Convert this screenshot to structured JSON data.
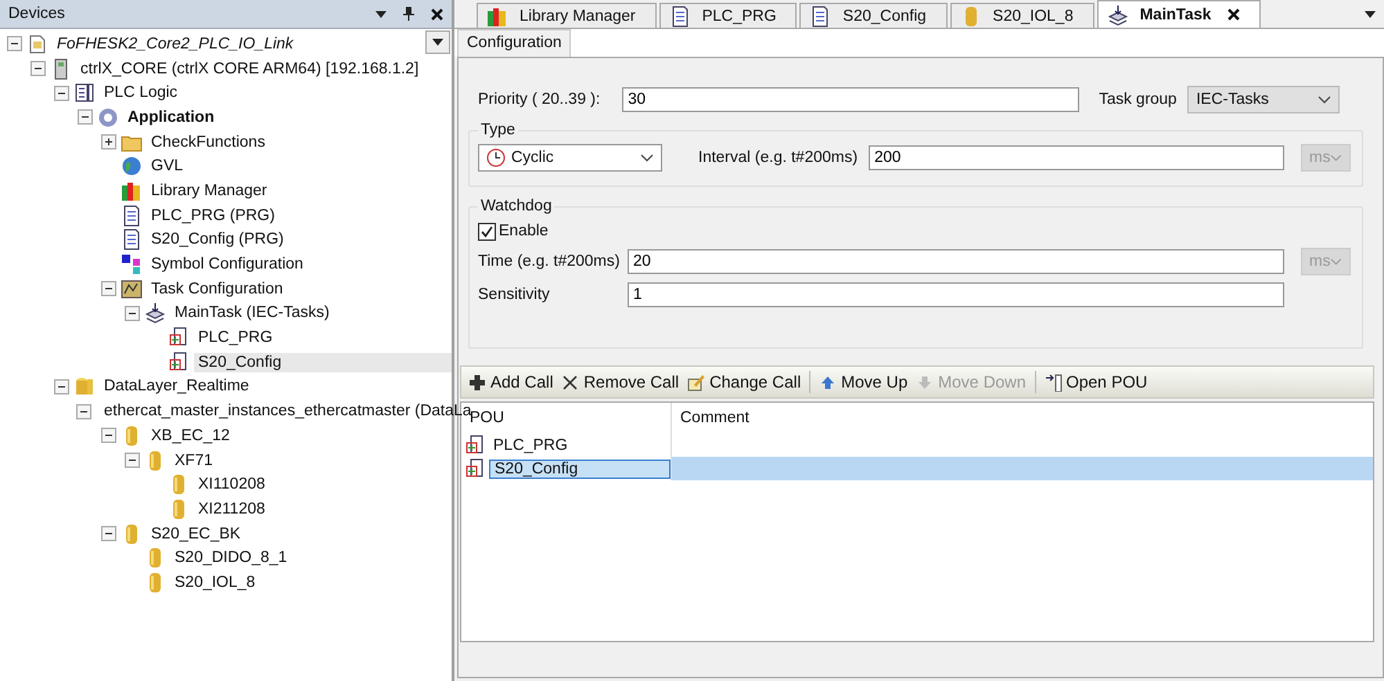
{
  "devices_panel": {
    "title": "Devices",
    "tree": [
      {
        "label": "FoFHESK2_Core2_PLC_IO_Link",
        "kind": "project",
        "expanded": true,
        "selected": false,
        "children": [
          {
            "label": "ctrlX_CORE (ctrlX CORE ARM64) [192.168.1.2]",
            "kind": "device",
            "expanded": true,
            "selected": false,
            "children": [
              {
                "label": "PLC Logic",
                "kind": "plc",
                "expanded": true,
                "selected": false,
                "children": [
                  {
                    "label": "Application",
                    "kind": "application",
                    "expanded": true,
                    "selected": false,
                    "children": [
                      {
                        "label": "CheckFunctions",
                        "kind": "folder",
                        "expanded": false,
                        "selected": false
                      },
                      {
                        "label": "GVL",
                        "kind": "globe",
                        "selected": false
                      },
                      {
                        "label": "Library Manager",
                        "kind": "library",
                        "selected": false
                      },
                      {
                        "label": "PLC_PRG (PRG)",
                        "kind": "pou",
                        "selected": false
                      },
                      {
                        "label": "S20_Config (PRG)",
                        "kind": "pou",
                        "selected": false
                      },
                      {
                        "label": "Symbol Configuration",
                        "kind": "symbols",
                        "selected": false
                      },
                      {
                        "label": "Task Configuration",
                        "kind": "taskconfig",
                        "expanded": true,
                        "selected": false,
                        "children": [
                          {
                            "label": "MainTask (IEC-Tasks)",
                            "kind": "task",
                            "expanded": true,
                            "selected": false,
                            "children": [
                              {
                                "label": "PLC_PRG",
                                "kind": "call",
                                "selected": false
                              },
                              {
                                "label": "S20_Config",
                                "kind": "call",
                                "selected": true
                              }
                            ]
                          }
                        ]
                      }
                    ]
                  }
                ]
              },
              {
                "label": "DataLayer_Realtime",
                "kind": "datalayer",
                "expanded": true,
                "selected": false,
                "children": [
                  {
                    "label": "ethercat_master_instances_ethercatmaster (DataLa",
                    "kind": "master",
                    "expanded": true,
                    "selected": false,
                    "children": [
                      {
                        "label": "XB_EC_12",
                        "kind": "node",
                        "expanded": true,
                        "selected": false,
                        "children": [
                          {
                            "label": "XF71",
                            "kind": "node",
                            "expanded": true,
                            "selected": false,
                            "children": [
                              {
                                "label": "XI110208",
                                "kind": "node",
                                "selected": false
                              },
                              {
                                "label": "XI211208",
                                "kind": "node",
                                "selected": false
                              }
                            ]
                          }
                        ]
                      },
                      {
                        "label": "S20_EC_BK",
                        "kind": "node",
                        "expanded": true,
                        "selected": false,
                        "children": [
                          {
                            "label": "S20_DIDO_8_1",
                            "kind": "node",
                            "selected": false
                          },
                          {
                            "label": "S20_IOL_8",
                            "kind": "node",
                            "selected": false
                          }
                        ]
                      }
                    ]
                  }
                ]
              }
            ]
          }
        ]
      }
    ]
  },
  "editor_tabs": [
    {
      "label": "Library Manager",
      "kind": "library",
      "selected": false
    },
    {
      "label": "PLC_PRG",
      "kind": "pou",
      "selected": false
    },
    {
      "label": "S20_Config",
      "kind": "pou",
      "selected": false
    },
    {
      "label": "S20_IOL_8",
      "kind": "node",
      "selected": false
    },
    {
      "label": "MainTask",
      "kind": "task",
      "selected": true
    }
  ],
  "sub_tabs": [
    {
      "label": "Configuration",
      "selected": true
    }
  ],
  "configuration": {
    "priority_label": "Priority ( 20..39 ):",
    "priority": "30",
    "task_group_label": "Task group",
    "task_group": "IEC-Tasks",
    "type_group": {
      "title": "Type",
      "type": "Cyclic",
      "interval_label": "Interval (e.g. t#200ms)",
      "interval": "200",
      "unit": "ms"
    },
    "watchdog": {
      "title": "Watchdog",
      "enable_label": "Enable",
      "checked": true,
      "time_label": "Time (e.g. t#200ms)",
      "time": "20",
      "unit": "ms",
      "sensitivity_label": "Sensitivity",
      "sensitivity": "1"
    },
    "toolbar": [
      {
        "label": "Add Call",
        "kind": "add",
        "disabled": false
      },
      {
        "label": "Remove Call",
        "kind": "remove",
        "disabled": false
      },
      {
        "label": "Change Call",
        "kind": "edit",
        "disabled": false
      },
      {
        "label": "Move Up",
        "kind": "up",
        "disabled": false
      },
      {
        "label": "Move Down",
        "kind": "down",
        "disabled": true
      },
      {
        "label": "Open POU",
        "kind": "open",
        "disabled": false
      }
    ],
    "table": {
      "columns": [
        "POU",
        "Comment"
      ],
      "rows": [
        {
          "pou": "PLC_PRG",
          "selected": false
        },
        {
          "pou": "S20_Config",
          "selected": true
        }
      ]
    }
  }
}
